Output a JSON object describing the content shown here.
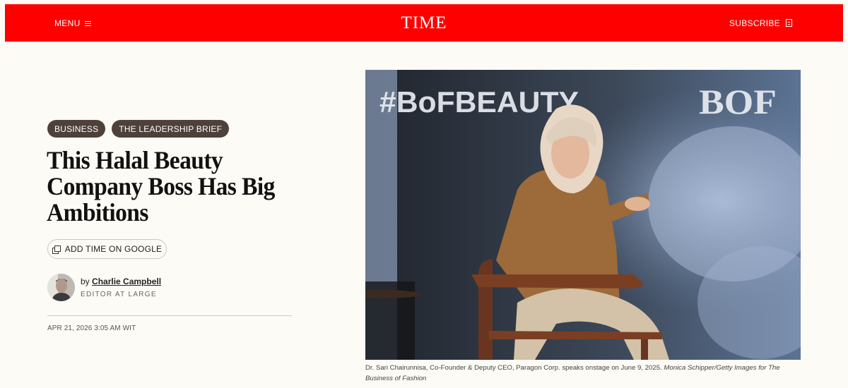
{
  "header": {
    "menu_label": "MENU",
    "logo": "TIME",
    "subscribe_label": "SUBSCRIBE",
    "bg_color": "#fe0000"
  },
  "article": {
    "tags": [
      "BUSINESS",
      "THE LEADERSHIP BRIEF"
    ],
    "headline": "This Halal Beauty Company Boss Has Big Ambitions",
    "google_button": "ADD TIME ON GOOGLE",
    "author_prefix": "by",
    "author_name": "Charlie Campbell",
    "author_role": "EDITOR AT LARGE",
    "date": "APR 21, 2026 3:05 AM WIT"
  },
  "hero": {
    "backdrop_text": "#BoFBEAUTY",
    "backdrop_logo": "BOF"
  },
  "caption": {
    "text": "Dr. Sari Chairunnisa, Co-Founder & Deputy CEO, Paragon Corp. speaks onstage on June 9, 2025.",
    "credit": "Monica Schipper/Getty Images for The Business of Fashion"
  }
}
